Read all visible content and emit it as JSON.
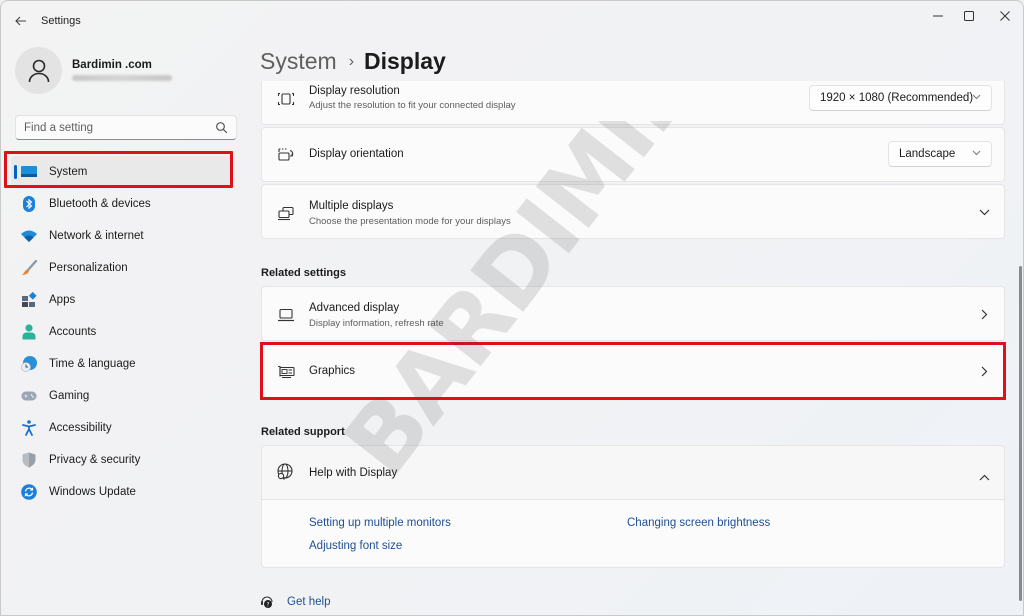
{
  "window": {
    "app_title": "Settings",
    "controls": {
      "minimize": "minimize",
      "maximize": "maximize",
      "close": "close"
    }
  },
  "profile": {
    "name": "Bardimin .com",
    "email_blurred": true
  },
  "search": {
    "placeholder": "Find a setting",
    "value": ""
  },
  "sidebar": {
    "items": [
      {
        "label": "System",
        "icon": "system-icon",
        "active": true,
        "color": "#0078d4"
      },
      {
        "label": "Bluetooth & devices",
        "icon": "bluetooth-icon",
        "active": false,
        "color": "#1a7fdd"
      },
      {
        "label": "Network & internet",
        "icon": "wifi-icon",
        "active": false,
        "color": "#1f8ad8"
      },
      {
        "label": "Personalization",
        "icon": "brush-icon",
        "active": false,
        "color": "#e08a3a"
      },
      {
        "label": "Apps",
        "icon": "apps-icon",
        "active": false,
        "color": "#4a5a6a"
      },
      {
        "label": "Accounts",
        "icon": "accounts-icon",
        "active": false,
        "color": "#2bb39a"
      },
      {
        "label": "Time & language",
        "icon": "time-language-icon",
        "active": false,
        "color": "#2b8fd8"
      },
      {
        "label": "Gaming",
        "icon": "gaming-icon",
        "active": false,
        "color": "#8a96a8"
      },
      {
        "label": "Accessibility",
        "icon": "accessibility-icon",
        "active": false,
        "color": "#1a6fd0"
      },
      {
        "label": "Privacy & security",
        "icon": "shield-icon",
        "active": false,
        "color": "#8a8f96"
      },
      {
        "label": "Windows Update",
        "icon": "windows-update-icon",
        "active": false,
        "color": "#1a7fdd"
      }
    ]
  },
  "breadcrumb": {
    "parent": "System",
    "separator": "›",
    "current": "Display"
  },
  "settings": {
    "display_resolution": {
      "title": "Display resolution",
      "subtitle": "Adjust the resolution to fit your connected display",
      "value": "1920 × 1080 (Recommended)"
    },
    "display_orientation": {
      "title": "Display orientation",
      "value": "Landscape"
    },
    "multiple_displays": {
      "title": "Multiple displays",
      "subtitle": "Choose the presentation mode for your displays",
      "expanded": false
    }
  },
  "related_settings": {
    "heading": "Related settings",
    "items": [
      {
        "title": "Advanced display",
        "subtitle": "Display information, refresh rate"
      },
      {
        "title": "Graphics",
        "subtitle": ""
      }
    ]
  },
  "related_support": {
    "heading": "Related support",
    "help_title": "Help with Display",
    "expanded": true,
    "links": [
      "Setting up multiple monitors",
      "Changing screen brightness",
      "Adjusting font size"
    ]
  },
  "footer": {
    "get_help": "Get help"
  },
  "annotations": {
    "highlight_color": "#e0101a",
    "highlighted": [
      "System",
      "Graphics"
    ]
  },
  "watermark": "BARDIMIN",
  "colors": {
    "accent": "#0067c0",
    "link": "#1f4f93"
  }
}
